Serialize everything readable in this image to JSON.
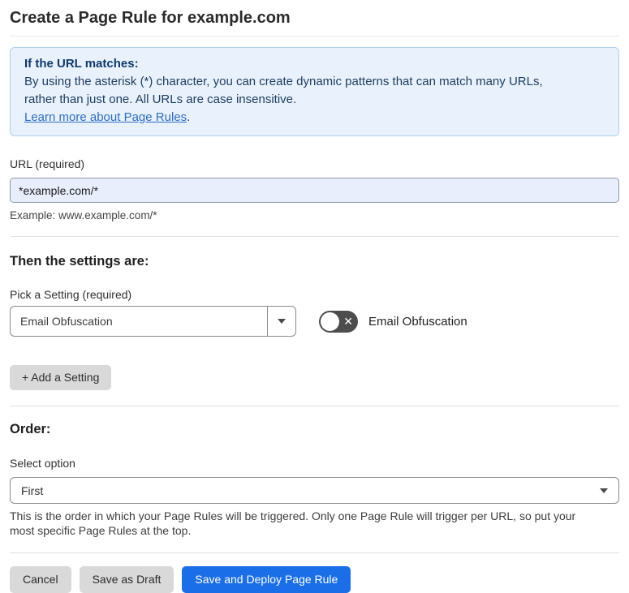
{
  "page": {
    "title": "Create a Page Rule for example.com"
  },
  "info_box": {
    "heading": "If the URL matches:",
    "body_line1": "By using the asterisk (*) character, you can create dynamic patterns that can match many URLs,",
    "body_line2": "rather than just one. All URLs are case insensitive.",
    "link": "Learn more about Page Rules",
    "link_suffix": "."
  },
  "url_section": {
    "label": "URL (required)",
    "value": "*example.com/*",
    "example": "Example: www.example.com/*"
  },
  "settings_section": {
    "heading": "Then the settings are:",
    "pick_label": "Pick a Setting (required)",
    "selected_setting": "Email Obfuscation",
    "toggle_label": "Email Obfuscation",
    "toggle_state": "off",
    "add_button": "+ Add a Setting"
  },
  "order_section": {
    "heading": "Order:",
    "select_label": "Select option",
    "selected_option": "First",
    "help_line1": "This is the order in which your Page Rules will be triggered. Only one Page Rule will trigger per URL, so put your",
    "help_line2": "most specific Page Rules at the top."
  },
  "footer": {
    "cancel": "Cancel",
    "save_draft": "Save as Draft",
    "save_deploy": "Save and Deploy Page Rule"
  },
  "icons": {
    "toggle_off": "✕"
  },
  "colors": {
    "accent_blue": "#1a6ee8",
    "info_bg": "#e9f2fc",
    "info_border": "#abcdec",
    "info_text": "#1e3d61",
    "link_blue": "#2c6cc4",
    "input_bg": "#e8eefb",
    "toggle_off_bg": "#4d4d4d",
    "button_gray": "#d9d9d9"
  }
}
